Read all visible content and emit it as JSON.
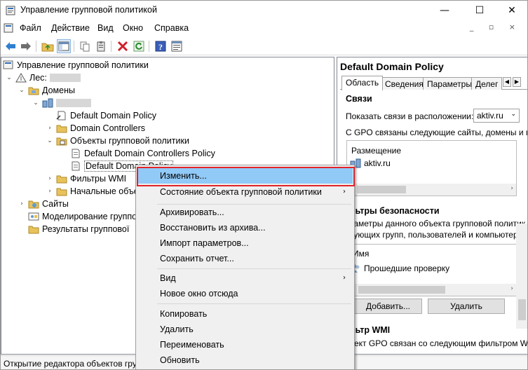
{
  "window": {
    "title": "Управление групповой политикой",
    "controls": {
      "minimize": "—",
      "maximize": "☐",
      "close": "✕"
    }
  },
  "menu": [
    "Файл",
    "Действие",
    "Вид",
    "Окно",
    "Справка"
  ],
  "mdi_controls": "_ ▫ ×",
  "toolbar": {
    "icons": [
      "back-icon",
      "forward-icon",
      "up-folder-icon",
      "show-tree-icon",
      "copy-icon",
      "paste-icon",
      "delete-icon",
      "refresh-icon",
      "help-icon",
      "properties-icon"
    ]
  },
  "tree": {
    "root": "Управление групповой политики",
    "forest": "Лес:",
    "domains": "Домены",
    "default_policy_link": "Default Domain Policy",
    "domain_controllers": "Domain Controllers",
    "gpo_container": "Объекты групповой политики",
    "gpo_dc_policy": "Default Domain Controllers Policy",
    "gpo_default_policy": "Default Domain Policy",
    "wmi_filters": "Фильтры WMI",
    "starter_gpos": "Начальные объе",
    "sites": "Сайты",
    "modeling": "Моделирование группо",
    "results": "Результаты группової"
  },
  "status_text": "Открытие редактора объектов гру",
  "right_pane": {
    "title": "Default Domain Policy",
    "tabs": [
      "Область",
      "Сведения",
      "Параметры",
      "Делег"
    ],
    "links_section": "Связи",
    "show_links_label": "Показать связи в расположении:",
    "location_value": "aktiv.ru",
    "linked_text": "С GPO связаны следующие сайты, домены и под",
    "links_column": "Размещение",
    "links_row": "aktiv.ru",
    "security_section": "ильтры безопасности",
    "security_text1": "араметры данного объекта групповой политик",
    "security_text2": "едующих групп, пользователей и компьютеро",
    "security_column": "Имя",
    "security_row": "Прошедшие проверку",
    "add_button": "Добавить...",
    "remove_button": "Удалить",
    "wmi_section": "ильтр WMI",
    "wmi_text": "бъект GPO связан со следующим фильтром W"
  },
  "context_menu": {
    "items": [
      {
        "label": "Изменить...",
        "highlighted": true
      },
      {
        "label": "Состояние объекта групповой политики",
        "submenu": true
      },
      {
        "label": "Архивировать..."
      },
      {
        "label": "Восстановить из архива..."
      },
      {
        "label": "Импорт параметров..."
      },
      {
        "label": "Сохранить отчет..."
      },
      {
        "label": "Вид",
        "submenu": true
      },
      {
        "label": "Новое окно отсюда"
      },
      {
        "label": "Копировать"
      },
      {
        "label": "Удалить"
      },
      {
        "label": "Переименовать"
      },
      {
        "label": "Обновить"
      }
    ],
    "submenu_arrow": "›"
  },
  "colors": {
    "highlight": "#91c9f7",
    "red_outline": "#e0242a",
    "folder": "#e8c25a"
  }
}
